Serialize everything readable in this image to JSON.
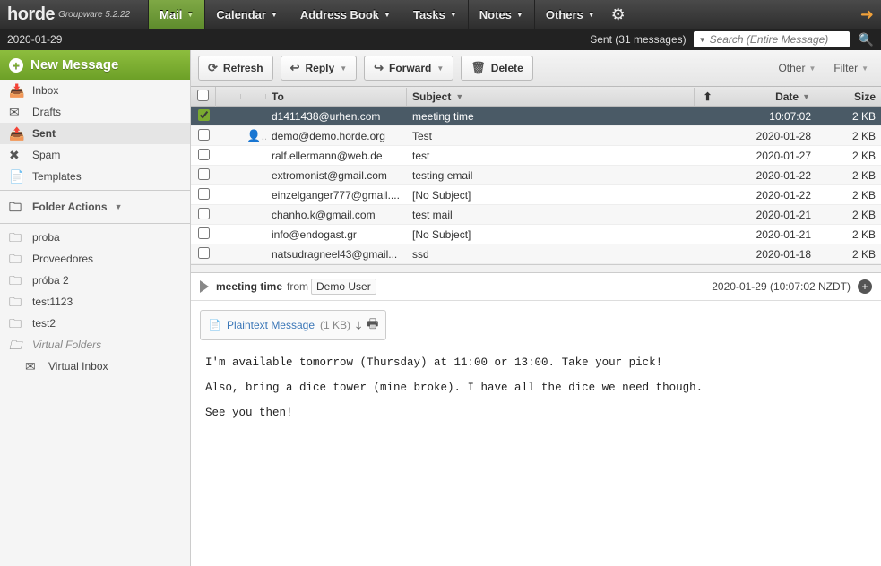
{
  "brand": {
    "name": "horde",
    "sub": "Groupware 5.2.22"
  },
  "topnav": [
    {
      "label": "Mail",
      "active": true
    },
    {
      "label": "Calendar"
    },
    {
      "label": "Address Book"
    },
    {
      "label": "Tasks"
    },
    {
      "label": "Notes"
    },
    {
      "label": "Others"
    }
  ],
  "subbar": {
    "date": "2020-01-29",
    "sent_text": "Sent (31 messages)",
    "search_placeholder": "Search (Entire Message)"
  },
  "sidebar": {
    "new_message": "New Message",
    "boxes": [
      {
        "label": "Inbox",
        "icon": "inbox"
      },
      {
        "label": "Drafts",
        "icon": "draft"
      },
      {
        "label": "Sent",
        "icon": "sent",
        "selected": true
      },
      {
        "label": "Spam",
        "icon": "spam"
      },
      {
        "label": "Templates",
        "icon": "template"
      }
    ],
    "folder_actions": "Folder Actions",
    "folders": [
      "proba",
      "Proveedores",
      "próba 2",
      "test1123",
      "test2"
    ],
    "virtual_label": "Virtual Folders",
    "virtual_inbox": "Virtual Inbox"
  },
  "toolbar": {
    "refresh": "Refresh",
    "reply": "Reply",
    "forward": "Forward",
    "delete": "Delete",
    "other": "Other",
    "filter": "Filter"
  },
  "columns": {
    "to": "To",
    "subject": "Subject",
    "date": "Date",
    "size": "Size"
  },
  "messages": [
    {
      "to": "d1411438@urhen.com",
      "subject": "meeting time",
      "date": "10:07:02",
      "size": "2 KB",
      "selected": true,
      "checked": true
    },
    {
      "to": "demo@demo.horde.org",
      "subject": "Test",
      "date": "2020-01-28",
      "size": "2 KB",
      "person": true
    },
    {
      "to": "ralf.ellermann@web.de",
      "subject": "test",
      "date": "2020-01-27",
      "size": "2 KB"
    },
    {
      "to": "extromonist@gmail.com",
      "subject": "testing email",
      "date": "2020-01-22",
      "size": "2 KB"
    },
    {
      "to": "einzelganger777@gmail....",
      "subject": "[No Subject]",
      "date": "2020-01-22",
      "size": "2 KB"
    },
    {
      "to": "chanho.k@gmail.com",
      "subject": "test mail",
      "date": "2020-01-21",
      "size": "2 KB"
    },
    {
      "to": "info@endogast.gr",
      "subject": "[No Subject]",
      "date": "2020-01-21",
      "size": "2 KB"
    },
    {
      "to": "natsudragneel43@gmail...",
      "subject": "ssd",
      "date": "2020-01-18",
      "size": "2 KB"
    }
  ],
  "preview": {
    "subject": "meeting time",
    "from_label": "from",
    "from_user": "Demo User",
    "timestamp": "2020-01-29 (10:07:02 NZDT)",
    "plaintext_label": "Plaintext Message",
    "plaintext_size": "(1 KB)",
    "body": "I'm available tomorrow (Thursday) at 11:00 or 13:00. Take your pick!\n\nAlso, bring a dice tower (mine broke). I have all the dice we need though.\n\nSee you then!"
  }
}
